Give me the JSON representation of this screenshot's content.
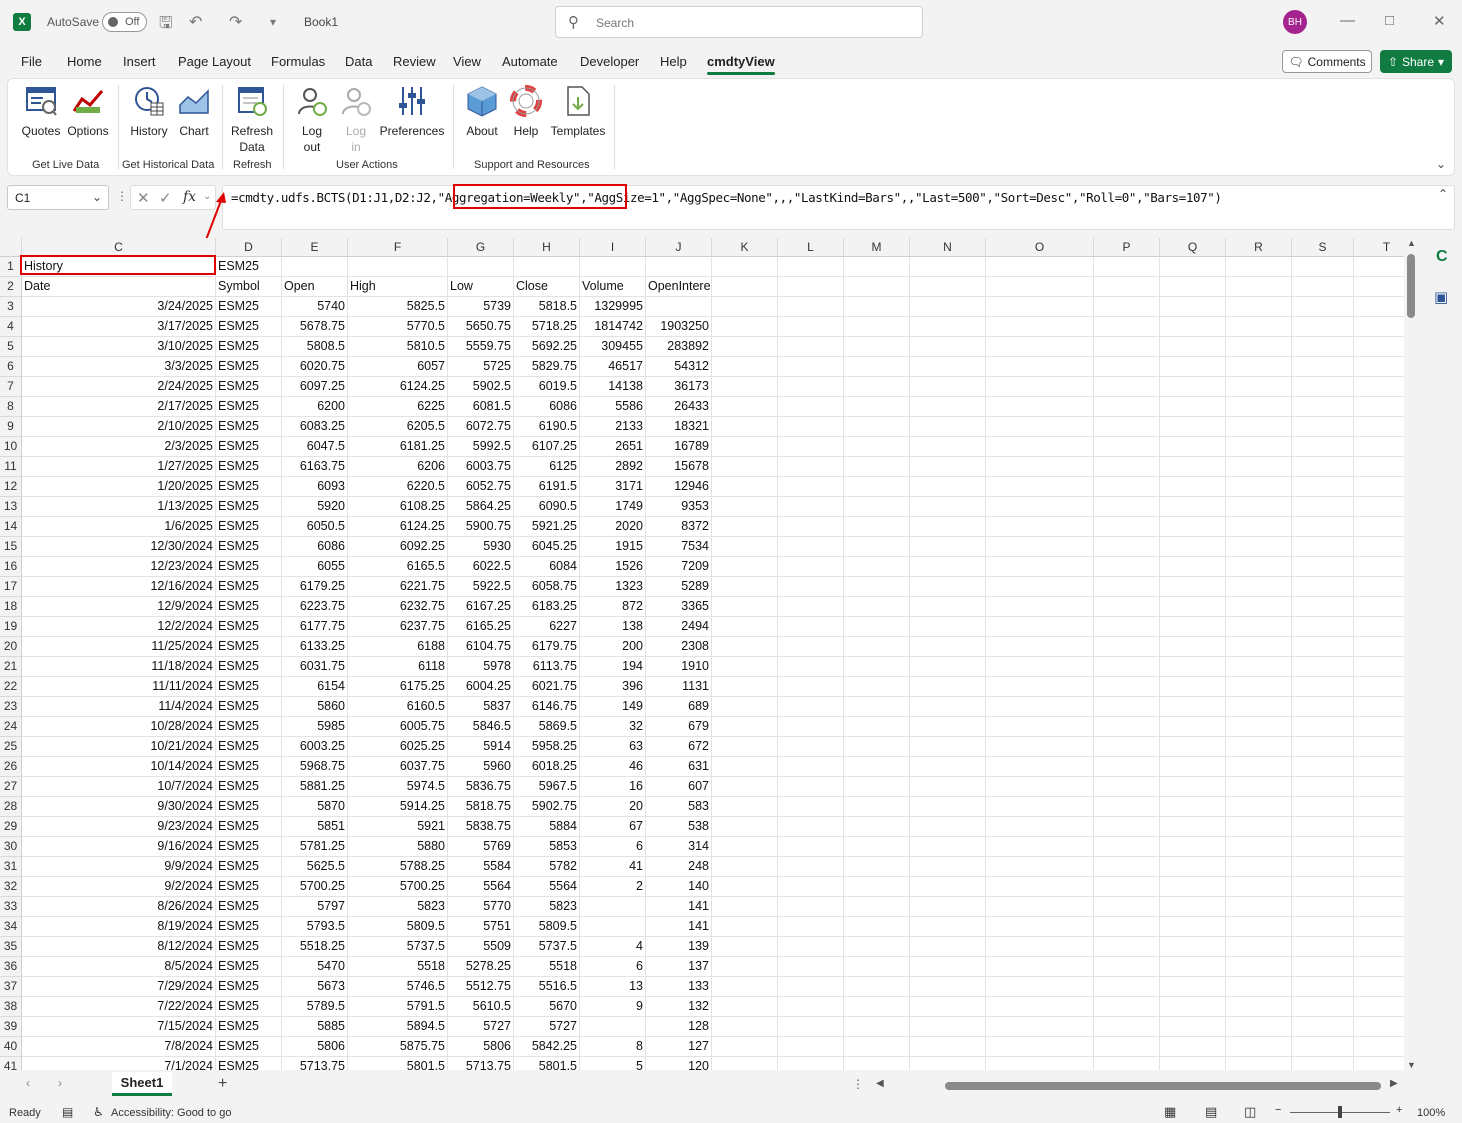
{
  "titlebar": {
    "autosave": "AutoSave",
    "toggle": "Off",
    "book": "Book1",
    "search_placeholder": "Search",
    "avatar": "BH"
  },
  "menu": {
    "tabs": [
      "File",
      "Home",
      "Insert",
      "Page Layout",
      "Formulas",
      "Data",
      "Review",
      "View",
      "Automate",
      "Developer",
      "Help",
      "cmdtyView"
    ],
    "active": "cmdtyView",
    "comments": "Comments",
    "share": "Share"
  },
  "ribbon": {
    "buttons": [
      {
        "label": "Quotes",
        "icon": "quotes-icon"
      },
      {
        "label": "Options",
        "icon": "options-icon"
      },
      {
        "label": "History",
        "icon": "history-icon"
      },
      {
        "label": "Chart",
        "icon": "chart-icon"
      },
      {
        "label": "Refresh\nData",
        "icon": "refresh-data-icon"
      },
      {
        "label": "Log\nout",
        "icon": "logout-icon"
      },
      {
        "label": "Log\nin",
        "icon": "login-icon"
      },
      {
        "label": "Preferences",
        "icon": "preferences-icon"
      },
      {
        "label": "About",
        "icon": "about-icon"
      },
      {
        "label": "Help",
        "icon": "help-icon"
      },
      {
        "label": "Templates",
        "icon": "templates-icon"
      }
    ],
    "groups": [
      "Get Live Data",
      "Get Historical Data",
      "Refresh",
      "User Actions",
      "Support and Resources"
    ]
  },
  "formula_bar": {
    "name_box": "C1",
    "fx": "fx",
    "formula": "=cmdty.udfs.BCTS(D1:J1,D2:J2,\"Aggregation=Weekly\",\"AggSize=1\",\"AggSpec=None\",,,\"LastKind=Bars\",,\"Last=500\",\"Sort=Desc\",\"Roll=0\",\"Bars=107\")"
  },
  "columns": [
    "C",
    "D",
    "E",
    "F",
    "G",
    "H",
    "I",
    "J",
    "K",
    "L",
    "M",
    "N",
    "O",
    "P",
    "Q",
    "R",
    "S",
    "T"
  ],
  "sheet": {
    "row1": {
      "c": "History",
      "d": "ESM25"
    },
    "headers": [
      "Date",
      "Symbol",
      "Open",
      "High",
      "Low",
      "Close",
      "Volume",
      "OpenInterest"
    ],
    "rows": [
      [
        "3/24/2025",
        "ESM25",
        "5740",
        "5825.5",
        "5739",
        "5818.5",
        "1329995",
        ""
      ],
      [
        "3/17/2025",
        "ESM25",
        "5678.75",
        "5770.5",
        "5650.75",
        "5718.25",
        "1814742",
        "1903250"
      ],
      [
        "3/10/2025",
        "ESM25",
        "5808.5",
        "5810.5",
        "5559.75",
        "5692.25",
        "309455",
        "283892"
      ],
      [
        "3/3/2025",
        "ESM25",
        "6020.75",
        "6057",
        "5725",
        "5829.75",
        "46517",
        "54312"
      ],
      [
        "2/24/2025",
        "ESM25",
        "6097.25",
        "6124.25",
        "5902.5",
        "6019.5",
        "14138",
        "36173"
      ],
      [
        "2/17/2025",
        "ESM25",
        "6200",
        "6225",
        "6081.5",
        "6086",
        "5586",
        "26433"
      ],
      [
        "2/10/2025",
        "ESM25",
        "6083.25",
        "6205.5",
        "6072.75",
        "6190.5",
        "2133",
        "18321"
      ],
      [
        "2/3/2025",
        "ESM25",
        "6047.5",
        "6181.25",
        "5992.5",
        "6107.25",
        "2651",
        "16789"
      ],
      [
        "1/27/2025",
        "ESM25",
        "6163.75",
        "6206",
        "6003.75",
        "6125",
        "2892",
        "15678"
      ],
      [
        "1/20/2025",
        "ESM25",
        "6093",
        "6220.5",
        "6052.75",
        "6191.5",
        "3171",
        "12946"
      ],
      [
        "1/13/2025",
        "ESM25",
        "5920",
        "6108.25",
        "5864.25",
        "6090.5",
        "1749",
        "9353"
      ],
      [
        "1/6/2025",
        "ESM25",
        "6050.5",
        "6124.25",
        "5900.75",
        "5921.25",
        "2020",
        "8372"
      ],
      [
        "12/30/2024",
        "ESM25",
        "6086",
        "6092.25",
        "5930",
        "6045.25",
        "1915",
        "7534"
      ],
      [
        "12/23/2024",
        "ESM25",
        "6055",
        "6165.5",
        "6022.5",
        "6084",
        "1526",
        "7209"
      ],
      [
        "12/16/2024",
        "ESM25",
        "6179.25",
        "6221.75",
        "5922.5",
        "6058.75",
        "1323",
        "5289"
      ],
      [
        "12/9/2024",
        "ESM25",
        "6223.75",
        "6232.75",
        "6167.25",
        "6183.25",
        "872",
        "3365"
      ],
      [
        "12/2/2024",
        "ESM25",
        "6177.75",
        "6237.75",
        "6165.25",
        "6227",
        "138",
        "2494"
      ],
      [
        "11/25/2024",
        "ESM25",
        "6133.25",
        "6188",
        "6104.75",
        "6179.75",
        "200",
        "2308"
      ],
      [
        "11/18/2024",
        "ESM25",
        "6031.75",
        "6118",
        "5978",
        "6113.75",
        "194",
        "1910"
      ],
      [
        "11/11/2024",
        "ESM25",
        "6154",
        "6175.25",
        "6004.25",
        "6021.75",
        "396",
        "1131"
      ],
      [
        "11/4/2024",
        "ESM25",
        "5860",
        "6160.5",
        "5837",
        "6146.75",
        "149",
        "689"
      ],
      [
        "10/28/2024",
        "ESM25",
        "5985",
        "6005.75",
        "5846.5",
        "5869.5",
        "32",
        "679"
      ],
      [
        "10/21/2024",
        "ESM25",
        "6003.25",
        "6025.25",
        "5914",
        "5958.25",
        "63",
        "672"
      ],
      [
        "10/14/2024",
        "ESM25",
        "5968.75",
        "6037.75",
        "5960",
        "6018.25",
        "46",
        "631"
      ],
      [
        "10/7/2024",
        "ESM25",
        "5881.25",
        "5974.5",
        "5836.75",
        "5967.5",
        "16",
        "607"
      ],
      [
        "9/30/2024",
        "ESM25",
        "5870",
        "5914.25",
        "5818.75",
        "5902.75",
        "20",
        "583"
      ],
      [
        "9/23/2024",
        "ESM25",
        "5851",
        "5921",
        "5838.75",
        "5884",
        "67",
        "538"
      ],
      [
        "9/16/2024",
        "ESM25",
        "5781.25",
        "5880",
        "5769",
        "5853",
        "6",
        "314"
      ],
      [
        "9/9/2024",
        "ESM25",
        "5625.5",
        "5788.25",
        "5584",
        "5782",
        "41",
        "248"
      ],
      [
        "9/2/2024",
        "ESM25",
        "5700.25",
        "5700.25",
        "5564",
        "5564",
        "2",
        "140"
      ],
      [
        "8/26/2024",
        "ESM25",
        "5797",
        "5823",
        "5770",
        "5823",
        "",
        "141"
      ],
      [
        "8/19/2024",
        "ESM25",
        "5793.5",
        "5809.5",
        "5751",
        "5809.5",
        "",
        "141"
      ],
      [
        "8/12/2024",
        "ESM25",
        "5518.25",
        "5737.5",
        "5509",
        "5737.5",
        "4",
        "139"
      ],
      [
        "8/5/2024",
        "ESM25",
        "5470",
        "5518",
        "5278.25",
        "5518",
        "6",
        "137"
      ],
      [
        "7/29/2024",
        "ESM25",
        "5673",
        "5746.5",
        "5512.75",
        "5516.5",
        "13",
        "133"
      ],
      [
        "7/22/2024",
        "ESM25",
        "5789.5",
        "5791.5",
        "5610.5",
        "5670",
        "9",
        "132"
      ],
      [
        "7/15/2024",
        "ESM25",
        "5885",
        "5894.5",
        "5727",
        "5727",
        "",
        "128"
      ],
      [
        "7/8/2024",
        "ESM25",
        "5806",
        "5875.75",
        "5806",
        "5842.25",
        "8",
        "127"
      ],
      [
        "7/1/2024",
        "ESM25",
        "5713.75",
        "5801.5",
        "5713.75",
        "5801.5",
        "5",
        "120"
      ]
    ]
  },
  "sheet_tabs": {
    "active": "Sheet1",
    "add": "+"
  },
  "status": {
    "ready": "Ready",
    "accessibility": "Accessibility: Good to go",
    "zoom": "100%"
  }
}
